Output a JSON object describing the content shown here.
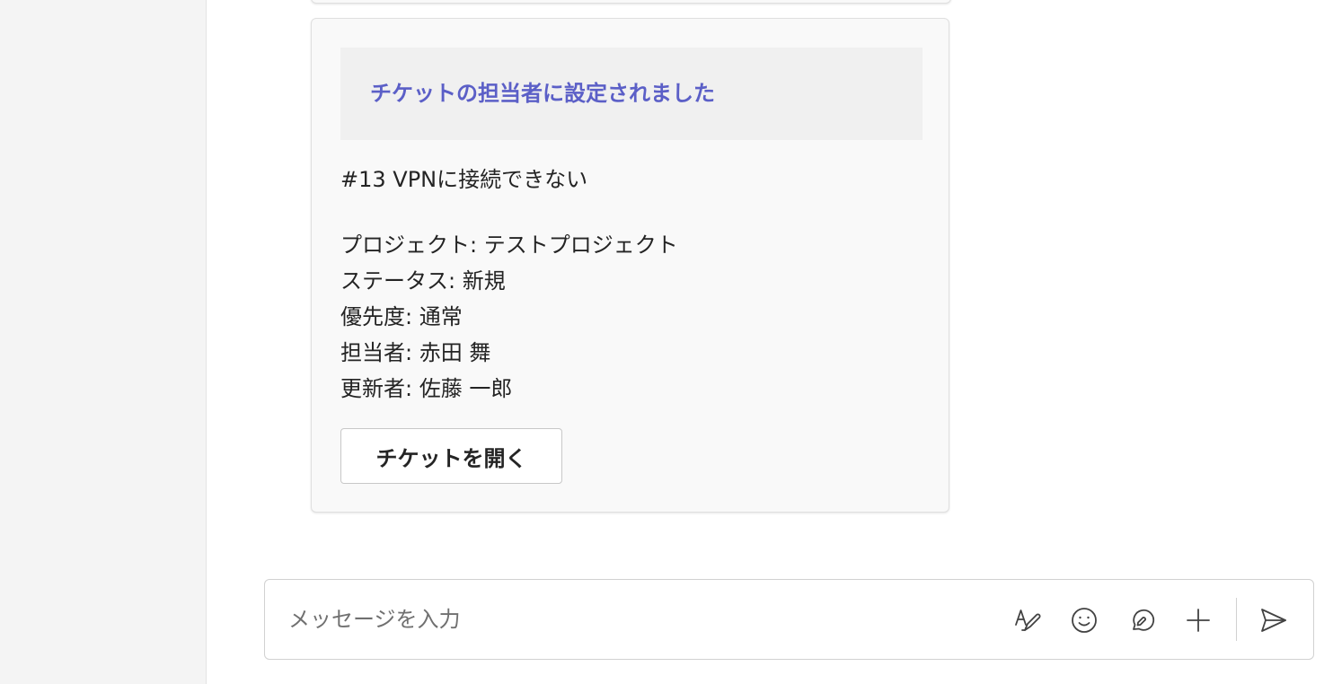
{
  "app": {
    "sidebar": {}
  },
  "card": {
    "header_title": "チケットの担当者に設定されました",
    "ticket_title": "#13 VPNに接続できない",
    "fields": [
      "プロジェクト: テストプロジェクト",
      "ステータス: 新規",
      "優先度: 通常",
      "担当者: 赤田 舞",
      "更新者: 佐藤 一郎"
    ],
    "open_button_label": "チケットを開く"
  },
  "composer": {
    "placeholder": "メッセージを入力",
    "tools": [
      "format-icon",
      "emoji-icon",
      "loop-icon",
      "plus-icon"
    ],
    "send_icon": "send-icon"
  },
  "colors": {
    "accent": "#5b5fc7",
    "text": "#242424",
    "sidebar_bg": "#f4f4f4",
    "card_bg": "#f9f9f9"
  }
}
